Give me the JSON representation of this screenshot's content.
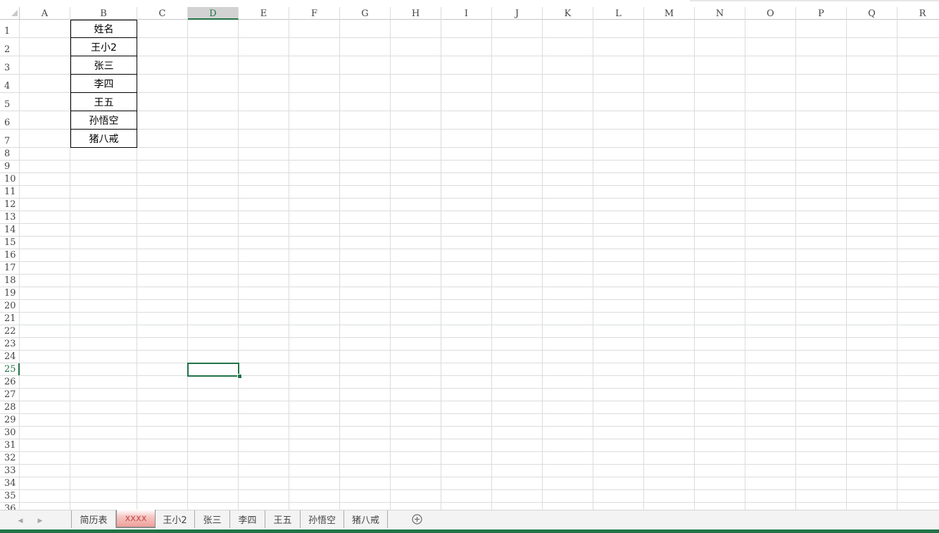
{
  "columns": [
    "A",
    "B",
    "C",
    "D",
    "E",
    "F",
    "G",
    "H",
    "I",
    "J",
    "K",
    "L",
    "M",
    "N",
    "O",
    "P",
    "Q",
    "R"
  ],
  "rows": [
    "1",
    "2",
    "3",
    "4",
    "5",
    "6",
    "7",
    "8",
    "9",
    "10",
    "11",
    "12",
    "13",
    "14",
    "15",
    "16",
    "17",
    "18",
    "19",
    "20",
    "21",
    "22",
    "23",
    "24",
    "25",
    "26",
    "27",
    "28",
    "29",
    "30",
    "31",
    "32",
    "33",
    "34",
    "35",
    "36"
  ],
  "active_column": "D",
  "active_row": "25",
  "cells_b": [
    "姓名",
    "王小2",
    "张三",
    "李四",
    "王五",
    "孙悟空",
    "猪八戒"
  ],
  "sheet_tabs": [
    "简历表",
    "xxxx",
    "王小2",
    "张三",
    "李四",
    "王五",
    "孙悟空",
    "猪八戒"
  ],
  "active_sheet": "xxxx",
  "colors": {
    "accent": "#217346",
    "gridline": "#dadcdd",
    "active_tab_fill": "#f6c7c4",
    "active_tab_text": "#c0504d"
  },
  "icons": {
    "prev_sheet": "chevron-left-icon",
    "next_sheet": "chevron-right-icon",
    "add_sheet": "plus-circle-icon",
    "select_all": "select-all-triangle-icon"
  }
}
